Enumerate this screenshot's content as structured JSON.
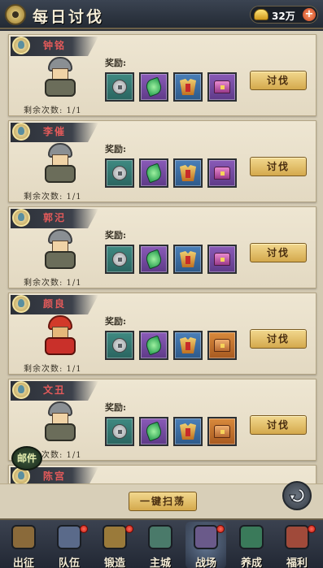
{
  "header": {
    "title": "每日讨伐",
    "gold": "32万",
    "plus": "+"
  },
  "rewards_label": "奖励:",
  "attack_label": "讨伐",
  "cards": [
    {
      "name": "钟铭",
      "remaining": "剩余次数: 1/1",
      "avatar": "grey-warrior",
      "rewards": [
        "coin",
        "jade",
        "armor",
        "chest-purple"
      ]
    },
    {
      "name": "李催",
      "remaining": "剩余次数: 1/1",
      "avatar": "grey-warrior",
      "rewards": [
        "coin",
        "jade",
        "armor",
        "chest-purple"
      ]
    },
    {
      "name": "郭汜",
      "remaining": "剩余次数: 1/1",
      "avatar": "grey-warrior",
      "rewards": [
        "coin",
        "jade",
        "armor",
        "chest-purple"
      ]
    },
    {
      "name": "颜良",
      "remaining": "剩余次数: 1/1",
      "avatar": "red-warrior",
      "rewards": [
        "coin",
        "jade",
        "armor",
        "chest-orange"
      ]
    },
    {
      "name": "文丑",
      "remaining": "剩余次数: 1/1",
      "avatar": "grey-warrior",
      "rewards": [
        "coin",
        "jade",
        "armor",
        "chest-orange"
      ]
    },
    {
      "name": "陈宫"
    }
  ],
  "mail_label": "邮件",
  "sweep_label": "一键扫荡",
  "nav": [
    {
      "label": "出征",
      "color": "#8a6a3a",
      "dot": false
    },
    {
      "label": "队伍",
      "color": "#5a6a8a",
      "dot": true
    },
    {
      "label": "锻造",
      "color": "#9a7a3a",
      "dot": true
    },
    {
      "label": "主城",
      "color": "#4a7a6a",
      "dot": false
    },
    {
      "label": "战场",
      "color": "#6a5a8a",
      "dot": true,
      "active": true
    },
    {
      "label": "养成",
      "color": "#3a7a5a",
      "dot": false
    },
    {
      "label": "福利",
      "color": "#a04a3a",
      "dot": true
    }
  ]
}
